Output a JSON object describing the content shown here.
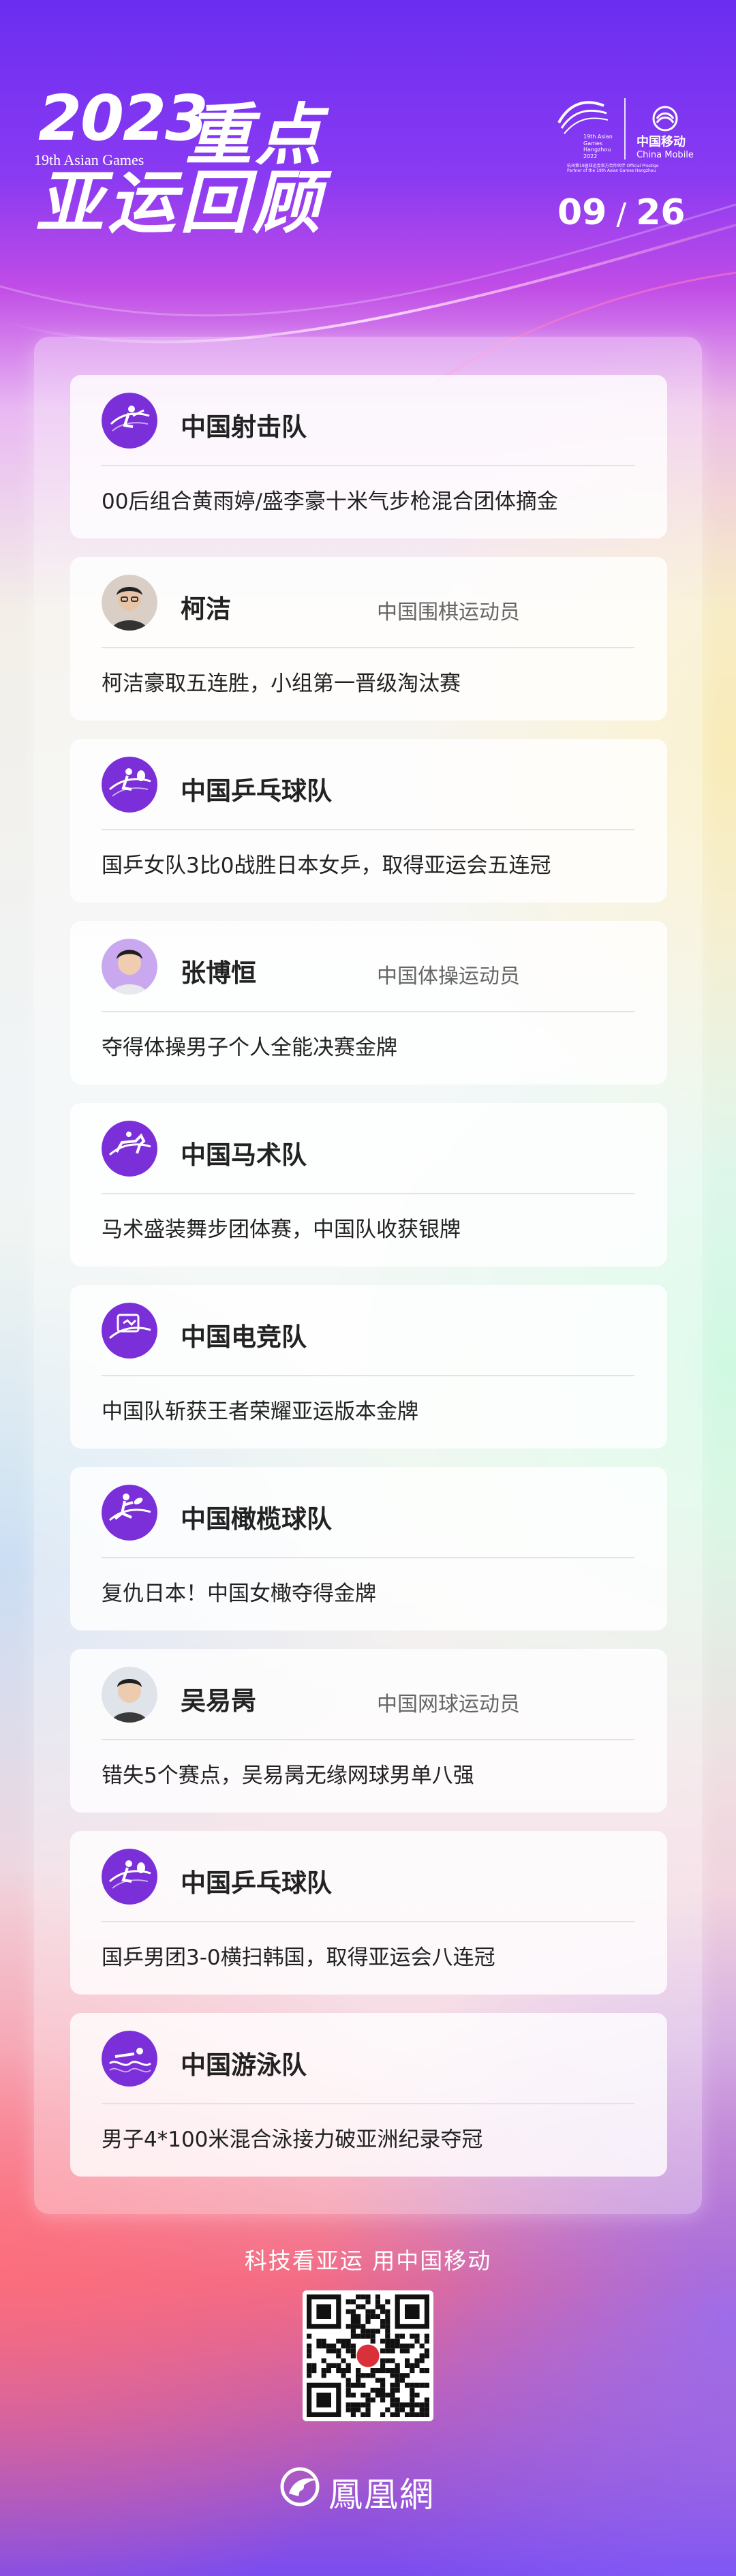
{
  "header": {
    "year": "2023",
    "games_label": "19th Asian Games",
    "title_line1": "重点",
    "title_line2": "亚运回顾",
    "hangzhou_en": "19th Asian Games Hangzhou 2022",
    "hangzhou_sub": "杭州第19届亚运会官方合作伙伴 Official Prestige Partner of the 19th Asian Games Hangzhou",
    "mobile_cn": "中国移动",
    "mobile_en": "China Mobile",
    "date_month": "09",
    "date_sep": "/",
    "date_day": "26"
  },
  "cards": [
    {
      "name": "中国射击队",
      "role": "",
      "desc": "00后组合黄雨婷/盛李豪十米气步枪混合团体摘金",
      "icon": "shooting-icon"
    },
    {
      "name": "柯洁",
      "role": "中国围棋运动员",
      "desc": "柯洁豪取五连胜，小组第一晋级淘汰赛",
      "icon": "avatar"
    },
    {
      "name": "中国乒乓球队",
      "role": "",
      "desc": "国乒女队3比0战胜日本女乒，取得亚运会五连冠",
      "icon": "table-tennis-icon"
    },
    {
      "name": "张博恒",
      "role": "中国体操运动员",
      "desc": "夺得体操男子个人全能决赛金牌",
      "icon": "avatar"
    },
    {
      "name": "中国马术队",
      "role": "",
      "desc": "马术盛装舞步团体赛，中国队收获银牌",
      "icon": "equestrian-icon"
    },
    {
      "name": "中国电竞队",
      "role": "",
      "desc": "中国队斩获王者荣耀亚运版本金牌",
      "icon": "esports-icon"
    },
    {
      "name": "中国橄榄球队",
      "role": "",
      "desc": "复仇日本！中国女橄夺得金牌",
      "icon": "rugby-icon"
    },
    {
      "name": "吴易昺",
      "role": "中国网球运动员",
      "desc": "错失5个赛点，吴易昺无缘网球男单八强",
      "icon": "avatar"
    },
    {
      "name": "中国乒乓球队",
      "role": "",
      "desc": "国乒男团3-0横扫韩国，取得亚运会八连冠",
      "icon": "table-tennis-icon"
    },
    {
      "name": "中国游泳队",
      "role": "",
      "desc": "男子4*100米混合泳接力破亚洲纪录夺冠",
      "icon": "swimming-icon"
    }
  ],
  "footer": {
    "slogan": "科技看亚运 用中国移动",
    "qr_icon": "qr-code-icon",
    "brand": "鳳凰網",
    "brand_icon": "ifeng-logo-icon"
  },
  "colors": {
    "icon_purple": "#7b2fd8",
    "header_purple": "#6a2ef0"
  }
}
